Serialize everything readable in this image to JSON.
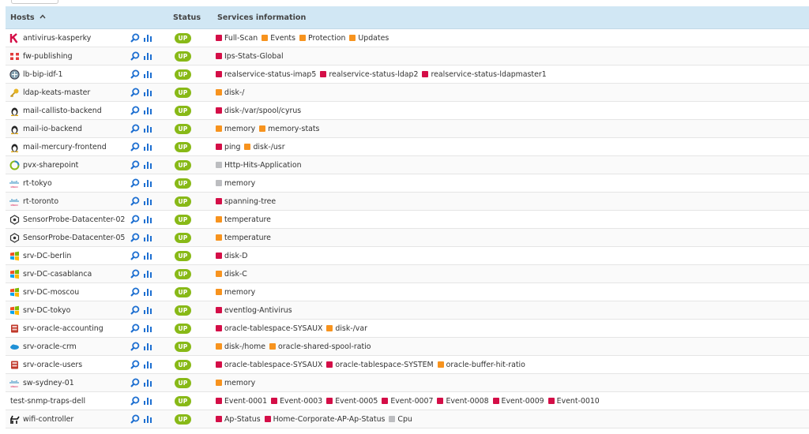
{
  "colors": {
    "header_bg": "#d1e7f4",
    "status_up": "#88b917",
    "critical": "#d40e47",
    "warning": "#f7931e",
    "unknown": "#bcbdc0",
    "action_icon": "#1d6fd1"
  },
  "header": {
    "hosts_label": "Hosts",
    "sort_indicator": "^",
    "status_label": "Status",
    "services_label": "Services information"
  },
  "rows": [
    {
      "host": "antivirus-kasperky",
      "icon": "kaspersky-icon",
      "status": "UP",
      "services": [
        {
          "name": "Full-Scan",
          "state": "critical"
        },
        {
          "name": "Events",
          "state": "warning"
        },
        {
          "name": "Protection",
          "state": "warning"
        },
        {
          "name": "Updates",
          "state": "warning"
        }
      ]
    },
    {
      "host": "fw-publishing",
      "icon": "fortinet-icon",
      "status": "UP",
      "services": [
        {
          "name": "Ips-Stats-Global",
          "state": "critical"
        }
      ]
    },
    {
      "host": "lb-bip-idf-1",
      "icon": "f5-icon",
      "status": "UP",
      "services": [
        {
          "name": "realservice-status-imap5",
          "state": "critical"
        },
        {
          "name": "realservice-status-ldap2",
          "state": "critical"
        },
        {
          "name": "realservice-status-ldapmaster1",
          "state": "critical"
        }
      ]
    },
    {
      "host": "ldap-keats-master",
      "icon": "key-icon",
      "status": "UP",
      "services": [
        {
          "name": "disk-/",
          "state": "warning"
        }
      ]
    },
    {
      "host": "mail-callisto-backend",
      "icon": "linux-icon",
      "status": "UP",
      "services": [
        {
          "name": "disk-/var/spool/cyrus",
          "state": "critical"
        }
      ]
    },
    {
      "host": "mail-io-backend",
      "icon": "linux-icon",
      "status": "UP",
      "services": [
        {
          "name": "memory",
          "state": "warning"
        },
        {
          "name": "memory-stats",
          "state": "warning"
        }
      ]
    },
    {
      "host": "mail-mercury-frontend",
      "icon": "linux-icon",
      "status": "UP",
      "services": [
        {
          "name": "ping",
          "state": "critical"
        },
        {
          "name": "disk-/usr",
          "state": "warning"
        }
      ]
    },
    {
      "host": "pvx-sharepoint",
      "icon": "pvx-icon",
      "status": "UP",
      "services": [
        {
          "name": "Http-Hits-Application",
          "state": "unknown"
        }
      ]
    },
    {
      "host": "rt-tokyo",
      "icon": "cisco-icon",
      "status": "UP",
      "services": [
        {
          "name": "memory",
          "state": "unknown"
        }
      ]
    },
    {
      "host": "rt-toronto",
      "icon": "cisco-icon",
      "status": "UP",
      "services": [
        {
          "name": "spanning-tree",
          "state": "critical"
        }
      ]
    },
    {
      "host": "SensorProbe-Datacenter-02",
      "icon": "sensorprobe-icon",
      "status": "UP",
      "services": [
        {
          "name": "temperature",
          "state": "warning"
        }
      ]
    },
    {
      "host": "SensorProbe-Datacenter-05",
      "icon": "sensorprobe-icon",
      "status": "UP",
      "services": [
        {
          "name": "temperature",
          "state": "warning"
        }
      ]
    },
    {
      "host": "srv-DC-berlin",
      "icon": "windows-icon",
      "status": "UP",
      "services": [
        {
          "name": "disk-D",
          "state": "critical"
        }
      ]
    },
    {
      "host": "srv-DC-casablanca",
      "icon": "windows-icon",
      "status": "UP",
      "services": [
        {
          "name": "disk-C",
          "state": "warning"
        }
      ]
    },
    {
      "host": "srv-DC-moscou",
      "icon": "windows-icon",
      "status": "UP",
      "services": [
        {
          "name": "memory",
          "state": "warning"
        }
      ]
    },
    {
      "host": "srv-DC-tokyo",
      "icon": "windows-icon",
      "status": "UP",
      "services": [
        {
          "name": "eventlog-Antivirus",
          "state": "critical"
        }
      ]
    },
    {
      "host": "srv-oracle-accounting",
      "icon": "oracle-db-icon",
      "status": "UP",
      "services": [
        {
          "name": "oracle-tablespace-SYSAUX",
          "state": "critical"
        },
        {
          "name": "disk-/var",
          "state": "warning"
        }
      ]
    },
    {
      "host": "srv-oracle-crm",
      "icon": "cloud-icon",
      "status": "UP",
      "services": [
        {
          "name": "disk-/home",
          "state": "warning"
        },
        {
          "name": "oracle-shared-spool-ratio",
          "state": "warning"
        }
      ]
    },
    {
      "host": "srv-oracle-users",
      "icon": "oracle-db-icon",
      "status": "UP",
      "services": [
        {
          "name": "oracle-tablespace-SYSAUX",
          "state": "critical"
        },
        {
          "name": "oracle-tablespace-SYSTEM",
          "state": "critical"
        },
        {
          "name": "oracle-buffer-hit-ratio",
          "state": "warning"
        }
      ]
    },
    {
      "host": "sw-sydney-01",
      "icon": "cisco-icon",
      "status": "UP",
      "services": [
        {
          "name": "memory",
          "state": "warning"
        }
      ]
    },
    {
      "host": "test-snmp-traps-dell",
      "icon": "",
      "status": "UP",
      "services": [
        {
          "name": "Event-0001",
          "state": "critical"
        },
        {
          "name": "Event-0003",
          "state": "critical"
        },
        {
          "name": "Event-0005",
          "state": "critical"
        },
        {
          "name": "Event-0007",
          "state": "critical"
        },
        {
          "name": "Event-0008",
          "state": "critical"
        },
        {
          "name": "Event-0009",
          "state": "critical"
        },
        {
          "name": "Event-0010",
          "state": "critical"
        }
      ]
    },
    {
      "host": "wifi-controller",
      "icon": "wifi-controller-icon",
      "status": "UP",
      "services": [
        {
          "name": "Ap-Status",
          "state": "critical"
        },
        {
          "name": "Home-Corporate-AP-Ap-Status",
          "state": "critical"
        },
        {
          "name": "Cpu",
          "state": "unknown"
        }
      ]
    }
  ]
}
